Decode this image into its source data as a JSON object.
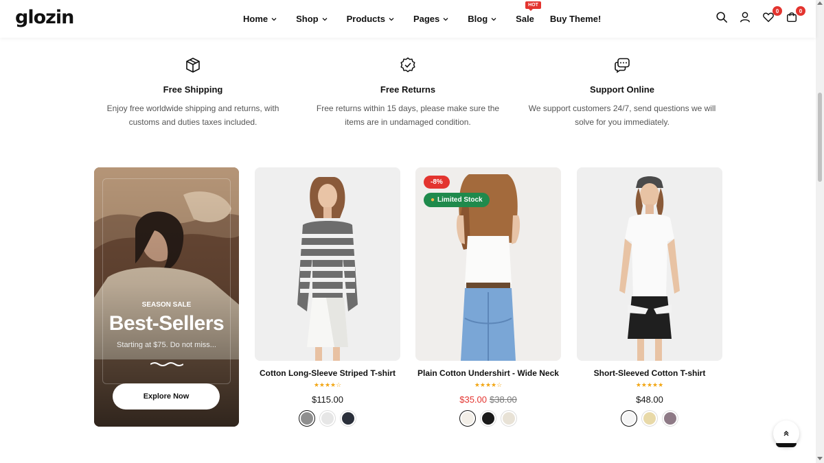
{
  "brand": {
    "logo": "glozin"
  },
  "nav": {
    "home": "Home",
    "shop": "Shop",
    "products": "Products",
    "pages": "Pages",
    "blog": "Blog",
    "sale": "Sale",
    "sale_badge": "HOT",
    "buy": "Buy Theme!"
  },
  "header_icons": {
    "wishlist_count": "0",
    "cart_count": "0"
  },
  "features": [
    {
      "icon": "box-icon",
      "title": "Free Shipping",
      "line1": "Enjoy free worldwide shipping and returns, with",
      "line2": "customs and duties taxes included."
    },
    {
      "icon": "badge-check-icon",
      "title": "Free Returns",
      "line1": "Free returns within 15 days, please make sure the",
      "line2": "items are in undamaged condition."
    },
    {
      "icon": "chat-icon",
      "title": "Support Online",
      "line1": "We support customers 24/7, send questions we will",
      "line2": "solve for you immediately."
    }
  ],
  "banner": {
    "eyebrow": "SEASON SALE",
    "title": "Best-Sellers",
    "subtitle": "Starting at $75. Do not miss...",
    "button": "Explore Now"
  },
  "products": [
    {
      "name": "Cotton Long-Sleeve Striped T-shirt",
      "rating": "★★★★☆",
      "price": "$115.00",
      "swatches": [
        "#8f8f8f",
        "#e6e6e6",
        "#2a2f3a"
      ]
    },
    {
      "name": "Plain Cotton Undershirt - Wide Neck",
      "rating": "★★★★☆",
      "sale_price": "$35.00",
      "old_price": "$38.00",
      "discount": "-8%",
      "stock": "Limited Stock",
      "swatches": [
        "#f3efe8",
        "#1a1a1a",
        "#e8e2d6"
      ]
    },
    {
      "name": "Short-Sleeved Cotton T-shirt",
      "rating": "★★★★★",
      "price": "$48.00",
      "swatches": [
        "#f5f5f5",
        "#e8d9a8",
        "#8e7a86"
      ]
    }
  ],
  "colors": {
    "accent_red": "#e3342f",
    "stock_green": "#1f8a4c",
    "star": "#f2a614"
  }
}
